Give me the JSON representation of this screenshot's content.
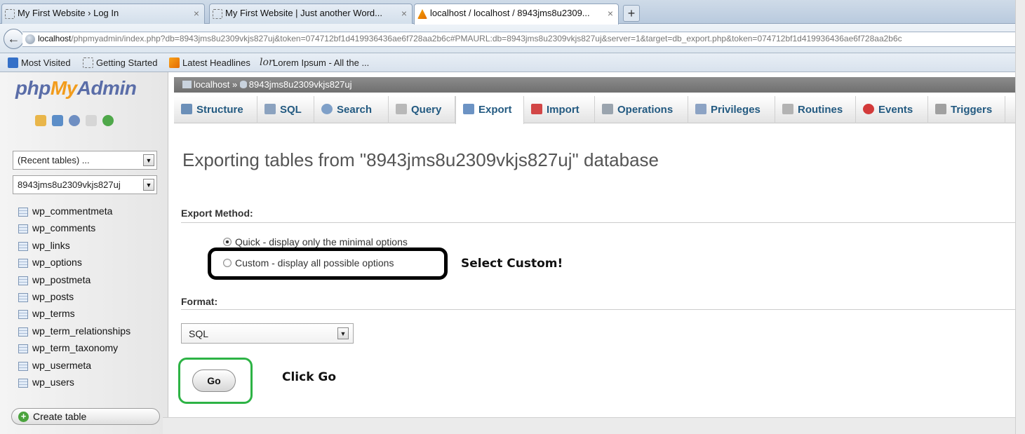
{
  "browser": {
    "tabs": [
      {
        "title": "My First Website › Log In",
        "active": false
      },
      {
        "title": "My First Website | Just another Word...",
        "active": false
      },
      {
        "title": "localhost / localhost / 8943jms8u2309...",
        "active": true
      }
    ],
    "new_tab_label": "+",
    "close_glyph": "×",
    "url_host": "localhost",
    "url_rest": "/phpmyadmin/index.php?db=8943jms8u2309vkjs827uj&token=074712bf1d419936436ae6f728aa2b6c#PMAURL:db=8943jms8u2309vkjs827uj&server=1&target=db_export.php&token=074712bf1d419936436ae6f728aa2b6c",
    "bookmarks": [
      {
        "label": "Most Visited",
        "icon": "most-visited-icon"
      },
      {
        "label": "Getting Started",
        "icon": "page-icon"
      },
      {
        "label": "Latest Headlines",
        "icon": "rss-icon"
      },
      {
        "label": "Lorem Ipsum - All the ...",
        "icon": "lorem-icon"
      }
    ],
    "lorem_glyph": "lor"
  },
  "sidebar": {
    "logo": {
      "php": "php",
      "my": "My",
      "admin": "Admin"
    },
    "recent_tables": "(Recent tables) ...",
    "database": "8943jms8u2309vkjs827uj",
    "tables": [
      "wp_commentmeta",
      "wp_comments",
      "wp_links",
      "wp_options",
      "wp_postmeta",
      "wp_posts",
      "wp_terms",
      "wp_term_relationships",
      "wp_term_taxonomy",
      "wp_usermeta",
      "wp_users"
    ],
    "create_table": "Create table",
    "dropdown_glyph": "▼",
    "plus_glyph": "+"
  },
  "breadcrumb": {
    "server": "localhost",
    "separator": "»",
    "database": "8943jms8u2309vkjs827uj"
  },
  "menu_tabs": [
    {
      "label": "Structure",
      "icon": "structure-icon",
      "color": "#6b8fb8"
    },
    {
      "label": "SQL",
      "icon": "sql-icon",
      "color": "#8ba2bf"
    },
    {
      "label": "Search",
      "icon": "search-icon",
      "color": "#7fa0c8"
    },
    {
      "label": "Query",
      "icon": "query-icon",
      "color": "#b8b8b8"
    },
    {
      "label": "Export",
      "icon": "export-icon",
      "color": "#6c93c4"
    },
    {
      "label": "Import",
      "icon": "import-icon",
      "color": "#d24646"
    },
    {
      "label": "Operations",
      "icon": "wrench-icon",
      "color": "#9aa4ae"
    },
    {
      "label": "Privileges",
      "icon": "privileges-icon",
      "color": "#8ca3c4"
    },
    {
      "label": "Routines",
      "icon": "routines-icon",
      "color": "#b3b3b3"
    },
    {
      "label": "Events",
      "icon": "clock-icon",
      "color": "#d33a3a"
    },
    {
      "label": "Triggers",
      "icon": "triggers-icon",
      "color": "#a0a0a0"
    }
  ],
  "main": {
    "heading": "Exporting tables from \"8943jms8u2309vkjs827uj\" database",
    "export_method_label": "Export Method:",
    "options": {
      "quick": "Quick - display only the minimal options",
      "custom": "Custom - display all possible options"
    },
    "selected_option": "quick",
    "format_label": "Format:",
    "format_value": "SQL",
    "go_label": "Go"
  },
  "annotations": {
    "select_custom": "Select Custom!",
    "click_go": "Click Go"
  }
}
